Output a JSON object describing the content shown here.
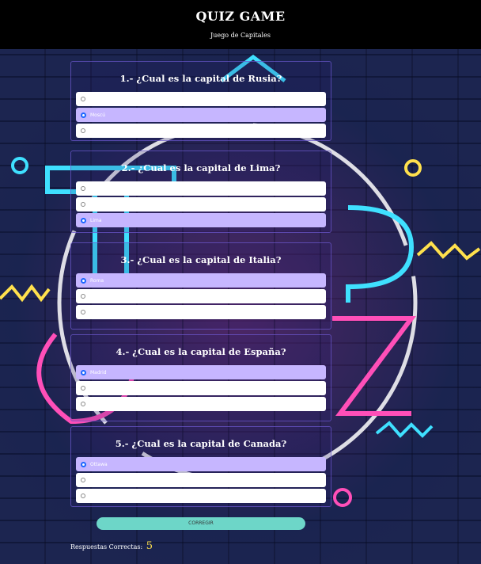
{
  "header": {
    "title": "QUIZ GAME",
    "subtitle": "Juego de Capitales"
  },
  "questions": [
    {
      "text": "1.- ¿Cual es la capital de Rusia?",
      "options": [
        "",
        "Moscú",
        ""
      ],
      "selected": 1
    },
    {
      "text": "2.- ¿Cual es la capital de Lima?",
      "options": [
        "",
        "",
        "Lima"
      ],
      "selected": 2
    },
    {
      "text": "3.- ¿Cual es la capital de Italia?",
      "options": [
        "Roma",
        "",
        ""
      ],
      "selected": 0
    },
    {
      "text": "4.- ¿Cual es la capital de España?",
      "options": [
        "Madrid",
        "",
        ""
      ],
      "selected": 0
    },
    {
      "text": "5.- ¿Cual es la capital de Canada?",
      "options": [
        "Ottawa",
        "",
        ""
      ],
      "selected": 0
    }
  ],
  "submit_label": "CORREGIR",
  "result": {
    "label": "Respuestas Correctas:",
    "score": "5"
  },
  "colors": {
    "header_bg": "#000000",
    "selected_option": "#c6b6ff",
    "button": "#6dd6c8",
    "score": "#ffe14d"
  }
}
